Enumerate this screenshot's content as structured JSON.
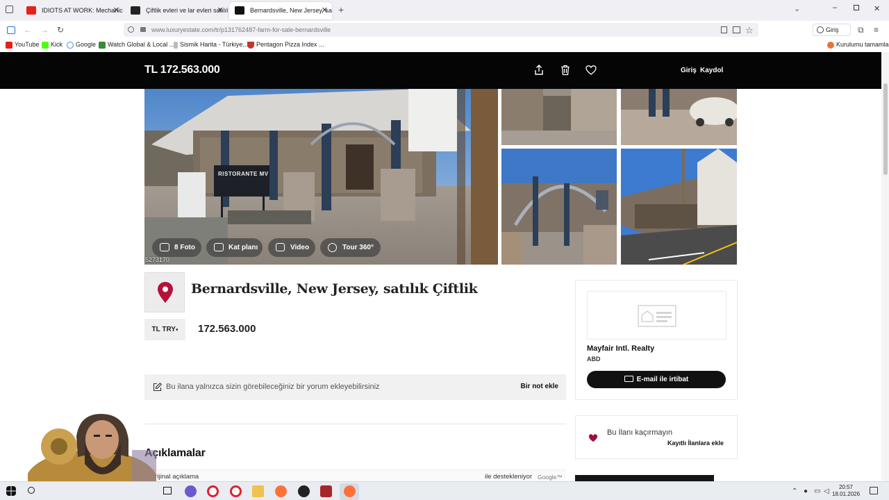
{
  "browser": {
    "tabs": [
      {
        "title": "IDIOTS AT WORK: Mechanic Ed",
        "active": false,
        "favicon_color": "#e62117"
      },
      {
        "title": "Çiftlik evleri ve lar evleri satılık",
        "active": false,
        "favicon_color": "#222222"
      },
      {
        "title": "Bernardsville, New Jersey, satılık",
        "active": true,
        "favicon_color": "#111111"
      }
    ],
    "new_tab": "+",
    "url_domain": "www.luxuryestate.com",
    "url_path": "/tr/p131762487-farm-for-sale-bernardsville",
    "profile_label": "Giriş yap",
    "bookmarks": [
      {
        "label": "YouTube",
        "color": "#e62117"
      },
      {
        "label": "Kick",
        "color": "#53fc18"
      },
      {
        "label": "Google",
        "color": "#4285f4"
      },
      {
        "label": "Watch Global & Local ...",
        "color": "#3a8a3a"
      },
      {
        "label": "Sismik Harita - Türkiye...",
        "color": "#999999"
      },
      {
        "label": "Pentagon Pizza Index ...",
        "color": "#c0392b"
      }
    ],
    "bookmark_right": "Kurulumu tamamla"
  },
  "header": {
    "price": "TL 172.563.000",
    "login": "Giriş",
    "register": "Kaydol",
    "icons": [
      "share-icon",
      "trash-icon",
      "heart-icon"
    ]
  },
  "gallery": {
    "photo_id": "5273170",
    "buttons": [
      {
        "label": "8 Foto",
        "icon": "camera-icon"
      },
      {
        "label": "Kat planı",
        "icon": "floorplan-icon"
      },
      {
        "label": "Video",
        "icon": "video-icon"
      },
      {
        "label": "Tour 360°",
        "icon": "tour-360-icon"
      }
    ],
    "sign_text": "RISTORANTE MV"
  },
  "listing": {
    "title": "Bernardsville, New Jersey, satılık Çiftlik",
    "currency": "TL TRY",
    "price": "172.563.000",
    "note_prompt": "Bu ilana yalnızca sizin görebileceğiniz bir yorum ekleyebilirsiniz",
    "note_button": "Bir not ekle",
    "description_title": "Açıklamalar",
    "original_description": "Orijinal açıklama",
    "powered_by": "ile destekleniyor",
    "google": "Google™"
  },
  "agent": {
    "name": "Mayfair Intl. Realty",
    "country": "ABD",
    "email_button": "E-mail ile irtibat"
  },
  "favorite": {
    "prompt": "Bu İlanı kaçırmayın",
    "action": "Kayıtlı İlanlara ekle"
  },
  "taskbar": {
    "time": "20:57",
    "date": "18.01.2026"
  },
  "colors": {
    "brand_black": "#050505",
    "pin_red": "#b5113b",
    "heart_red": "#9c0f3a"
  }
}
